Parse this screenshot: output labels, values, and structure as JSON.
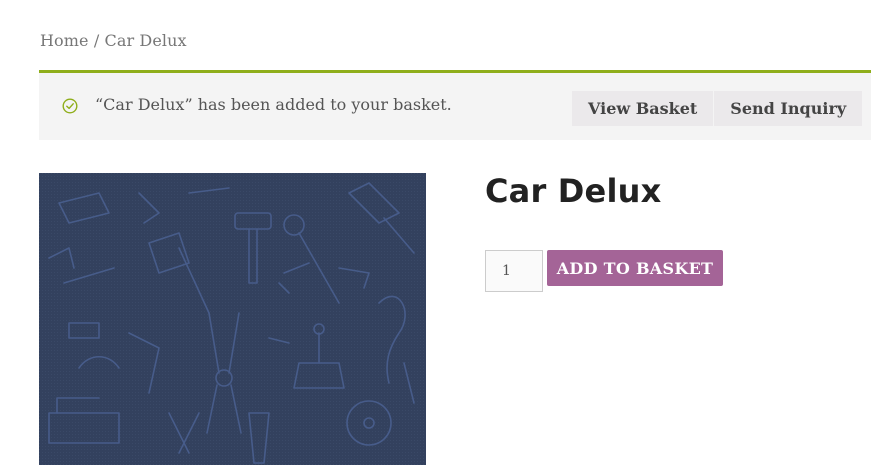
{
  "breadcrumb": {
    "home": "Home",
    "separator": " / ",
    "current": "Car Delux"
  },
  "notice": {
    "message": "“Car Delux” has been added to your basket.",
    "icon": "check-circle-icon",
    "accent_color": "#8fae1b",
    "view_basket_label": "View Basket",
    "send_inquiry_label": "Send Inquiry"
  },
  "product": {
    "title": "Car Delux",
    "image_description_icon": "tools-pattern-image",
    "image_bg_color": "#33415e",
    "quantity": "1",
    "add_to_basket_label": "ADD TO BASKET",
    "button_color": "#a46497"
  }
}
